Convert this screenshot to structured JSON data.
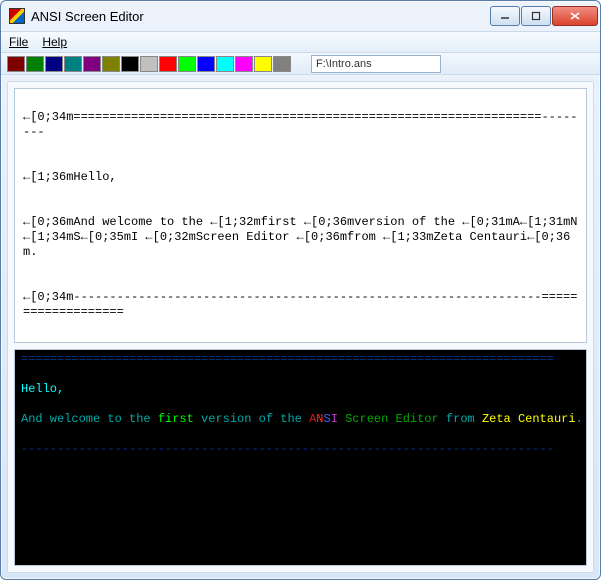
{
  "window": {
    "title": "ANSI Screen Editor",
    "btn_min": "—",
    "btn_max": "▭",
    "btn_close": "✕"
  },
  "menu": {
    "file": "File",
    "help": "Help"
  },
  "toolbar": {
    "colors": [
      "#800000",
      "#008000",
      "#000080",
      "#008080",
      "#800080",
      "#808000",
      "#000000",
      "#c0c0c0",
      "#ff0000",
      "#00ff00",
      "#0000ff",
      "#00ffff",
      "#ff00ff",
      "#ffff00",
      "#808080"
    ],
    "file_path": "F:\\Intro.ans"
  },
  "source": {
    "line1": "←[0;34m=================================================================--------",
    "blank1": "",
    "line2": "←[1;36mHello,",
    "blank2": "",
    "line3": "←[0;36mAnd welcome to the ←[1;32mfirst ←[0;36mversion of the ←[0;31mA←[1;31mN←[1;34mS←[0;35mI ←[0;32mScreen Editor ←[0;36mfrom ←[1;33mZeta Centauri←[0;36m.",
    "blank3": "",
    "line4": "←[0;34m-----------------------------------------------------------------==================="
  },
  "preview": {
    "rule": "==========================================================================",
    "hello": "Hello,",
    "p2_a": "And welcome to the ",
    "p2_first": "first ",
    "p2_b": "version of the ",
    "p2_A": "A",
    "p2_N": "N",
    "p2_S": "S",
    "p2_I": "I ",
    "p2_editor": "Screen Editor ",
    "p2_from": "from ",
    "p2_zeta": "Zeta Centauri",
    "p2_dot": ".",
    "rule2": "--------------------------------------------------------------------------"
  }
}
